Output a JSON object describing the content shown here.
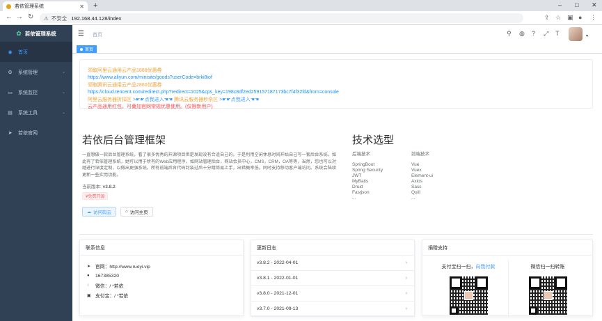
{
  "browser": {
    "tab_title": "若依管理系统",
    "new_tab": "+",
    "insecure_label": "不安全",
    "url": "192.168.44.128/index"
  },
  "sidebar": {
    "logo": "若依管理系统",
    "items": [
      {
        "label": "首页",
        "icon": "dashboard-icon",
        "active": true
      },
      {
        "label": "系统管理",
        "icon": "gear-icon",
        "arrow": true
      },
      {
        "label": "系统监控",
        "icon": "monitor-icon",
        "arrow": true
      },
      {
        "label": "系统工具",
        "icon": "tool-icon",
        "arrow": true
      },
      {
        "label": "若依官网",
        "icon": "send-icon"
      }
    ]
  },
  "header": {
    "breadcrumb": "首页"
  },
  "tags": {
    "active": "首页"
  },
  "promo": {
    "line1": "领取阿里云通用云产品1888优惠券",
    "line2": "https://www.aliyun.com/minisite/goods?userCode=brki8iof",
    "line3": "领取腾讯云通用云产品2860优惠券",
    "line4": "https://cloud.tencent.com/redirect.php?redirect=1025&cps_key=198c8df2ed259157187173bc7f4f32fd&from=console",
    "line5a": "阿里云服务器折扣区",
    "line5b": ">☛☛点我进入☚☚",
    "line5c": "腾讯云服务器秒杀区",
    "line5d": ">☛☛点我进入☚☚",
    "line6": "云产品通用红包，可叠加官网常规优惠使用。(仅限新用户)"
  },
  "intro": {
    "title": "若依后台管理框架",
    "text": "一直想做一款后台管理系统，看了很多优秀的开源项目但是发现没有合适自己的。于是利用空闲休息时间开始自己写一套后台系统。如此有了若依管理系统，她可以用于所有的Web应用程序，如网站管理后台，网站会员中心，CMS，CRM，OA等等，当然，您也可以对她进行深度定制，以做出更强系统。所有前端后台代码封装过后十分精简易上手，出错概率低。同时支持移动客户端访问。系统会陆续更新一些实用功能。",
    "version_label": "当前版本:",
    "version": "v3.8.2",
    "free_tag": "¥免费开源",
    "btn_gitee": "访问码云",
    "btn_home": "访问主页"
  },
  "tech": {
    "title": "技术选型",
    "backend_title": "后端技术",
    "backend": [
      "SpringBoot",
      "Spring Security",
      "JWT",
      "MyBatis",
      "Druid",
      "Fastjson",
      "..."
    ],
    "frontend_title": "前端技术",
    "frontend": [
      "Vue",
      "Vuex",
      "Element-ui",
      "Axios",
      "Sass",
      "Quill",
      "..."
    ]
  },
  "contact": {
    "title": "联系信息",
    "website": "官网：http://www.ruoyi.vip",
    "qq": "167385320",
    "wechat": "微信：/ *若依",
    "alipay": "支付宝：/ *若依"
  },
  "changelog": {
    "title": "更新日志",
    "items": [
      "v3.8.2 - 2022-04-01",
      "v3.8.1 - 2022-01-01",
      "v3.8.0 - 2021-12-01",
      "v3.7.0 - 2021-09-13"
    ]
  },
  "donate": {
    "title": "捐赠支持",
    "alipay_prefix": "支付宝扫一扫，",
    "alipay_accent": "向我付款",
    "wechat": "微信扫一扫转账"
  }
}
